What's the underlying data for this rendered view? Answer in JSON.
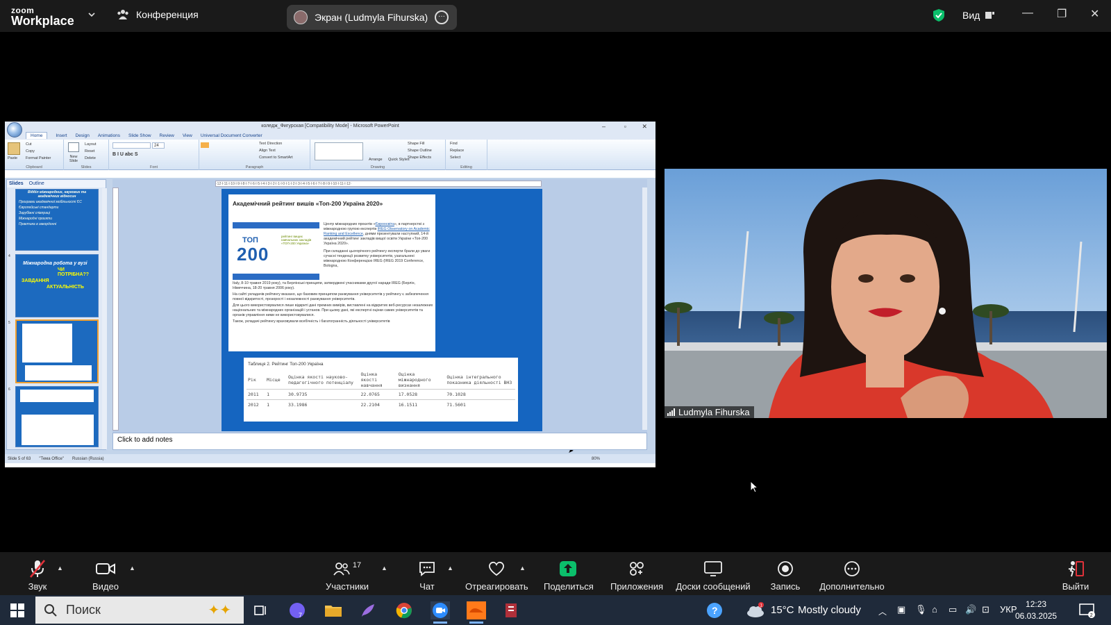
{
  "topbar": {
    "brand_line1": "zoom",
    "brand_line2": "Workplace",
    "conference_label": "Конференция",
    "screen_share_label": "Экран (Ludmyla Fihurska)",
    "view_label": "Вид"
  },
  "powerpoint": {
    "title": "коледж_Фигурская [Compatibility Mode] - Microsoft PowerPoint",
    "tabs": [
      "Home",
      "Insert",
      "Design",
      "Animations",
      "Slide Show",
      "Review",
      "View",
      "Universal Document Converter"
    ],
    "ribbon": {
      "clipboard": {
        "label": "Clipboard",
        "paste": "Paste",
        "cut": "Cut",
        "copy": "Copy",
        "format_painter": "Format Painter"
      },
      "slides": {
        "label": "Slides",
        "new_slide": "New Slide",
        "layout": "Layout",
        "reset": "Reset",
        "delete": "Delete"
      },
      "font": {
        "label": "Font",
        "size": "24"
      },
      "paragraph": {
        "label": "Paragraph",
        "text_direction": "Text Direction",
        "align_text": "Align Text",
        "convert": "Convert to SmartArt"
      },
      "drawing": {
        "label": "Drawing",
        "arrange": "Arrange",
        "quick_styles": "Quick Styles",
        "shape_fill": "Shape Fill",
        "shape_outline": "Shape Outline",
        "shape_effects": "Shape Effects"
      },
      "editing": {
        "label": "Editing",
        "find": "Find",
        "replace": "Replace",
        "select": "Select"
      }
    },
    "pane_tabs": [
      "Slides",
      "Outline"
    ],
    "thumbs": {
      "t3_title": "Відділ міжнародних, наукових та академічних відносин",
      "t3_items": [
        "Програми академічної мобільності ЄС",
        "Європейські стандарти",
        "Зарубіжні співпраці",
        "Міжнародні проєкти",
        "Практика в закордонні"
      ],
      "t4_title": "Міжнародна робота у вузі",
      "t4_q": "ЧИ ПОТРІБНА??",
      "t4_a": "ЗАВДАННЯ",
      "t4_b": "АКТУАЛЬНІСТЬ",
      "nums": [
        "4",
        "5",
        "6"
      ]
    },
    "ruler_text": "·12·l·11·l·10·l·9·l·8·l·7·l·6·l·5·l·4·l·3·l·2·l·1·l·0·l·1·l·2·l·3·l·4·l·5·l·6·l·7·l·8·l·9·l·10·l·11·l·12·",
    "slide": {
      "heading": "Академічний рейтинг вишів «Топ-200 Україна 2020»",
      "logo_top": "ТОП",
      "logo_200": "200",
      "logo_sub": "рейтинг вищих навчальних закладів «ТОП-200 Україна»",
      "p1_a": "Центр міжнародних проєктів «",
      "p1_link1": "Євроосвіта",
      "p1_b": "», в партнерстві з міжнародною групою експертів ",
      "p1_link2": "IREG Observatory on Academic Ranking and Excellence",
      "p1_c": ", днями презентували наступний, 14-й академічний рейтинг закладів вищої освіти України «Топ-200 Україна 2020».",
      "p2": "При складанні цьогорічного рейтингу експерти брали до уваги сучасні тенденції розвитку університетів, узагальнені міжнародною Конференцією IREG (IREG 2019 Conference, Bologna,",
      "p3": "Italy, 8-10 травня 2019 року), та Берлінські принципи, затверджені учасниками другої наради IREG (Берлін, Німеччина, 18-20 травня 2006 року).",
      "p4": "На сайті укладачів рейтингу вказано, що базовим принципом ранжування університетів у рейтингу є забезпечення повної відкритості, прозорості і незалежності ранжування університетів.",
      "p5": "Для цього використовувалися лише відкриті дані премних вимірів, виставлені на відкритих веб-ресурсах незалежних національних та міжнародних організацій і установ. При цьому дані, які експертні оцінки самих університетів та органів управління ними не використовувалися.",
      "p6": "Також, укладачі рейтингу враховували всебічність і багатогранність діяльності університетів",
      "table_caption": "Таблиця 2. Рейтинг Топ-200 Україна",
      "table_headers": [
        "Рік",
        "Місце",
        "Оцінка якості науково-педагогічного потенціалу",
        "Оцінка якості навчання",
        "Оцінка міжнародного визнання",
        "Оцінка інтегрального показника діяльності ВНЗ"
      ],
      "table_rows": [
        [
          "2011",
          "1",
          "30.9735",
          "22.0765",
          "17.0528",
          "70.1028"
        ],
        [
          "2012",
          "1",
          "33.1986",
          "22.2104",
          "16.1511",
          "71.5601"
        ]
      ]
    },
    "notes_placeholder": "Click to add notes",
    "status": {
      "slide": "Slide 5 of 63",
      "theme": "\"Тема Office\"",
      "language": "Russian (Russia)",
      "zoom": "80%"
    }
  },
  "video": {
    "participant_name": "Ludmyla Fihurska"
  },
  "toolbar": {
    "audio": "Звук",
    "video": "Видео",
    "participants": "Участники",
    "participants_count": "17",
    "chat": "Чат",
    "react": "Отреагировать",
    "share": "Поделиться",
    "apps": "Приложения",
    "whiteboards": "Доски сообщений",
    "record": "Запись",
    "more": "Дополнительно",
    "leave": "Выйти"
  },
  "taskbar": {
    "search_placeholder": "Поиск",
    "weather_temp": "15°C",
    "weather_desc": "Mostly cloudy",
    "weather_badge": "1",
    "lang": "УКР",
    "time": "12:23",
    "date": "06.03.2025",
    "notif_count": "2",
    "viber_badge": "7"
  },
  "colors": {
    "zoom_dark": "#1a1a1a",
    "share_green": "#0bbf6b",
    "slide_blue": "#1565c0",
    "taskbar": "#1f2a3a"
  }
}
